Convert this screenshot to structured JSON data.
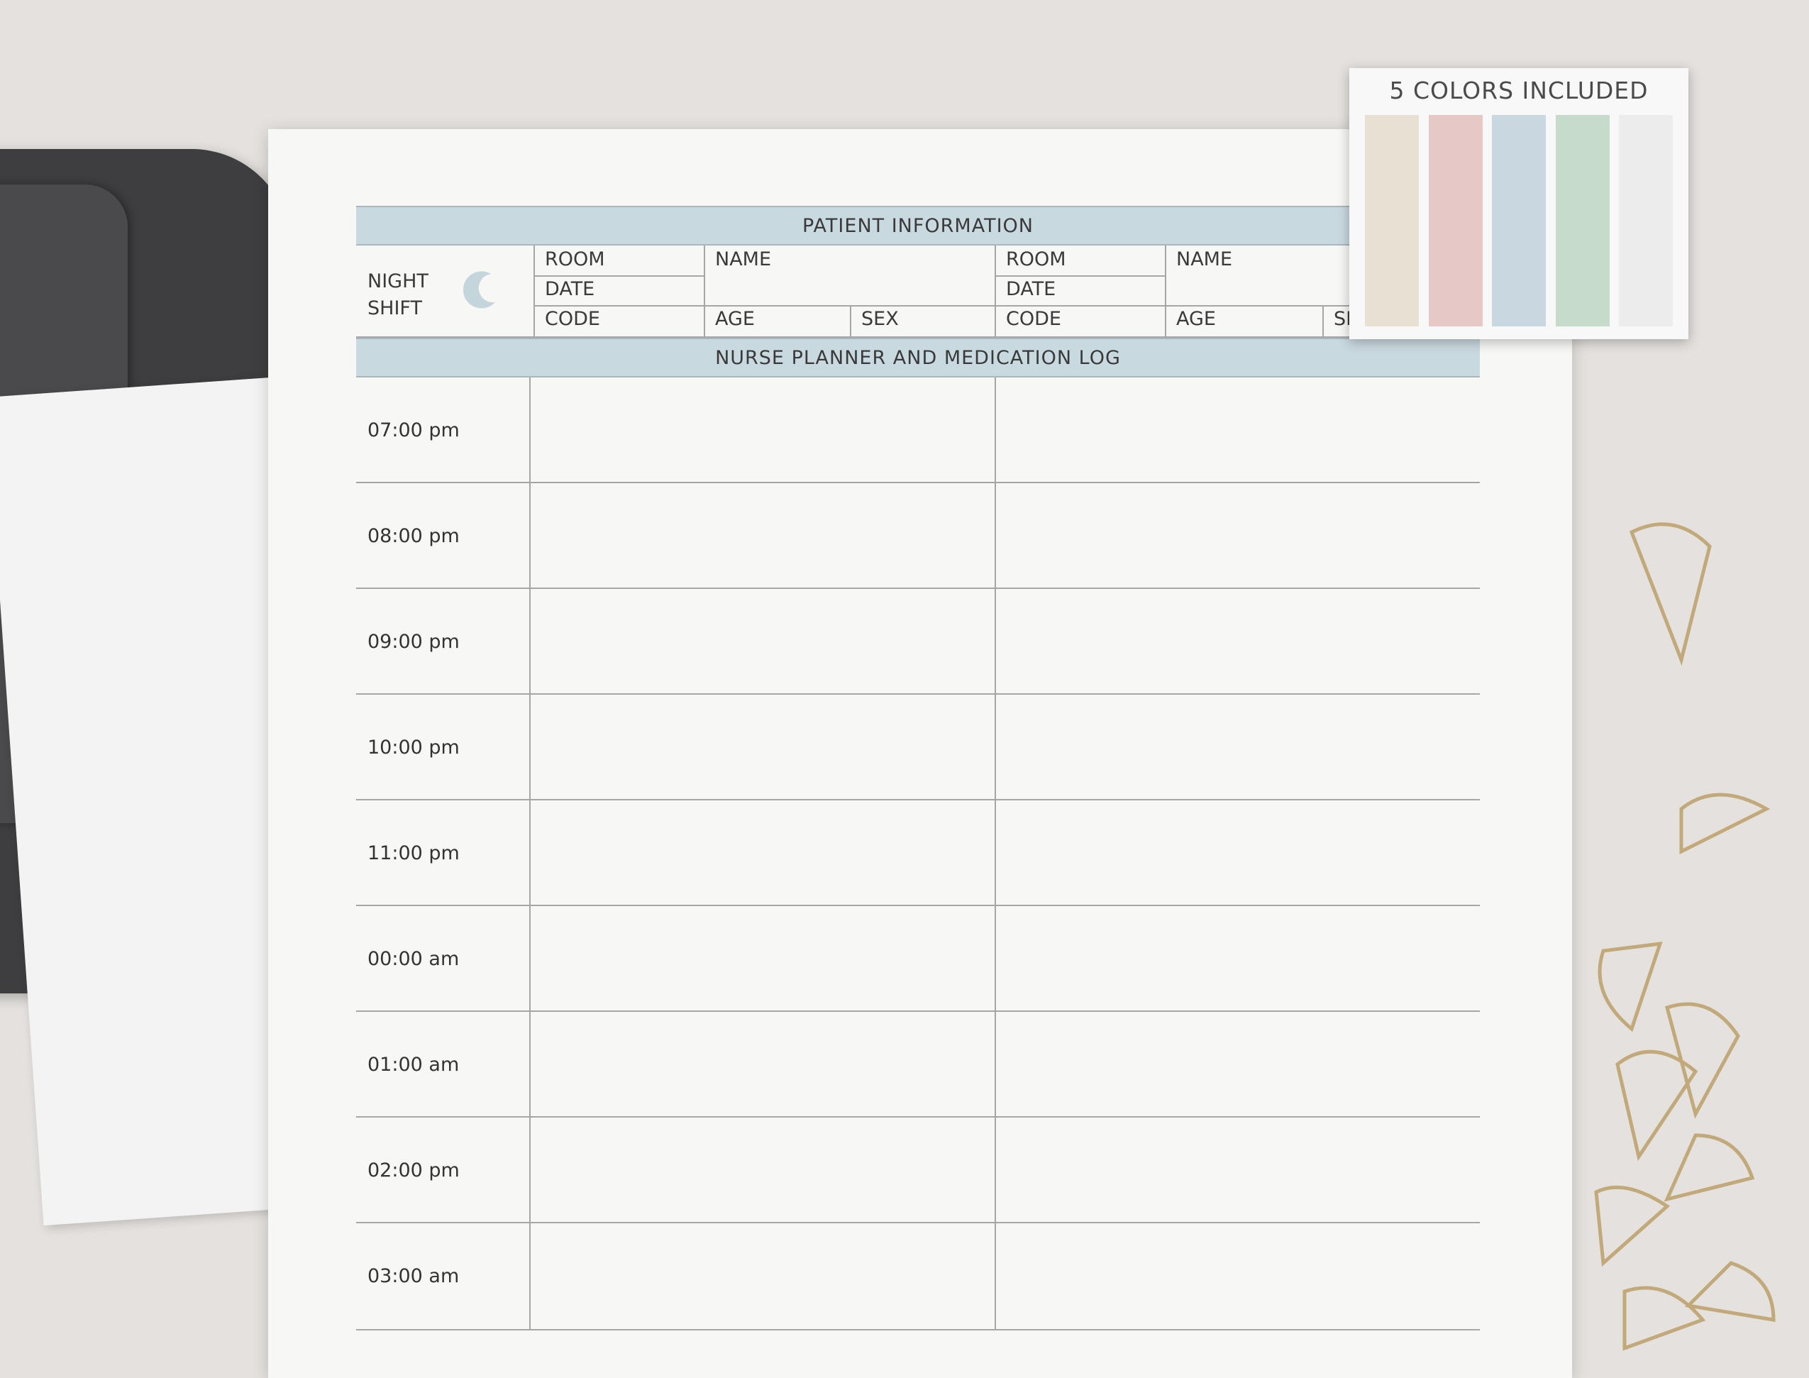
{
  "header": {
    "patient_information": "PATIENT INFORMATION",
    "log_title": "NURSE PLANNER AND MEDICATION LOG"
  },
  "shift": {
    "line1": "NIGHT",
    "line2": "SHIFT",
    "icon": "moon-icon"
  },
  "fields": {
    "room": "ROOM",
    "date": "DATE",
    "code": "CODE",
    "name": "NAME",
    "age": "AGE",
    "sex": "SEX",
    "sex_partial": "SE"
  },
  "times": [
    "07:00 pm",
    "08:00 pm",
    "09:00 pm",
    "10:00 pm",
    "11:00 pm",
    "00:00 am",
    "01:00 am",
    "02:00 pm",
    "03:00 am"
  ],
  "swatch_card": {
    "title": "5 COLORS INCLUDED",
    "colors": [
      "#e9e0d4",
      "#e6c9c6",
      "#c9d8e0",
      "#c6dbcc",
      "#ececec"
    ]
  },
  "colors": {
    "band": "#c9d9e0",
    "moon": "#c5d5dc"
  }
}
